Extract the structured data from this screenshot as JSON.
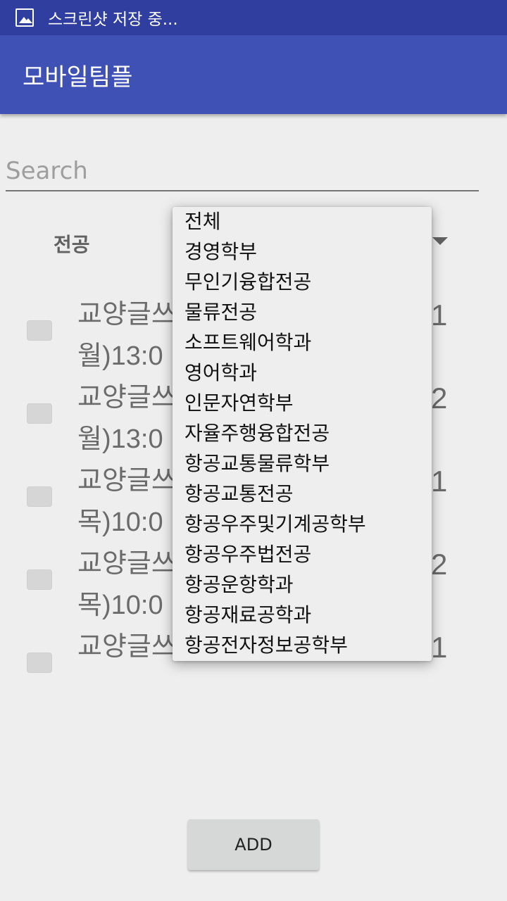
{
  "status_bar": {
    "text": "스크린샷 저장 중...",
    "icon": "image-icon"
  },
  "app_bar": {
    "title": "모바일팀플"
  },
  "search": {
    "placeholder": "Search",
    "value": ""
  },
  "filter": {
    "label": "전공"
  },
  "courses": [
    {
      "line1": "교양글쓰",
      "line2": "월)13:0",
      "num": "1",
      "checked": false
    },
    {
      "line1": "교양글쓰",
      "line2": "월)13:0",
      "num": "2",
      "checked": false
    },
    {
      "line1": "교양글쓰",
      "line2": "목)10:0",
      "num": "1",
      "checked": false
    },
    {
      "line1": "교양글쓰",
      "line2": "목)10:0",
      "num": "2",
      "checked": false
    },
    {
      "line1": "교양글쓰",
      "line2": "",
      "num": "1",
      "checked": false
    }
  ],
  "dropdown": {
    "options": [
      "전체",
      "경영학부",
      "무인기융합전공",
      "물류전공",
      "소프트웨어학과",
      "영어학과",
      "인문자연학부",
      "자율주행융합전공",
      "항공교통물류학부",
      "항공교통전공",
      "항공우주및기계공학부",
      "항공우주법전공",
      "항공운항학과",
      "항공재료공학과",
      "항공전자정보공학부"
    ]
  },
  "add_button": {
    "label": "ADD"
  },
  "colors": {
    "primary": "#3f51b5",
    "primary_dark": "#303f9f",
    "background": "#eeeeee"
  }
}
